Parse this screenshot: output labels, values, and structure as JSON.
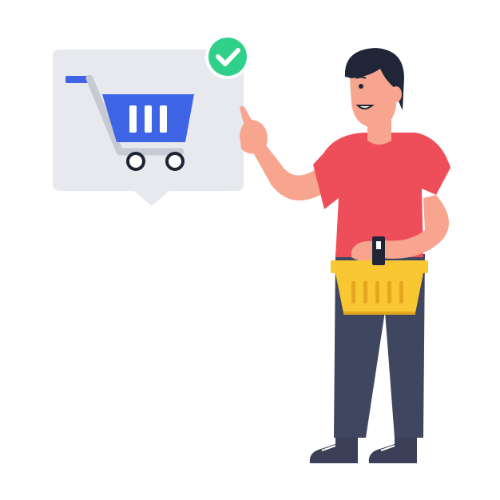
{
  "scene": {
    "subject": "man-with-shopping-basket",
    "icons": [
      "shopping-cart-icon",
      "check-icon",
      "basket-icon"
    ],
    "colors": {
      "background": "#ffffff",
      "bubble": "#e7e9ee",
      "bubble_shadow": "#d9dce3",
      "cart_blue": "#3f64e6",
      "cart_gray": "#c7cad3",
      "check_green": "#2fd18a",
      "shirt": "#ee4d5a",
      "skin": "#f7a58f",
      "hair": "#202637",
      "pants": "#3f4660",
      "basket": "#f8c731",
      "basket_dark": "#e3a81e",
      "shoes": "#3b3f57"
    }
  }
}
